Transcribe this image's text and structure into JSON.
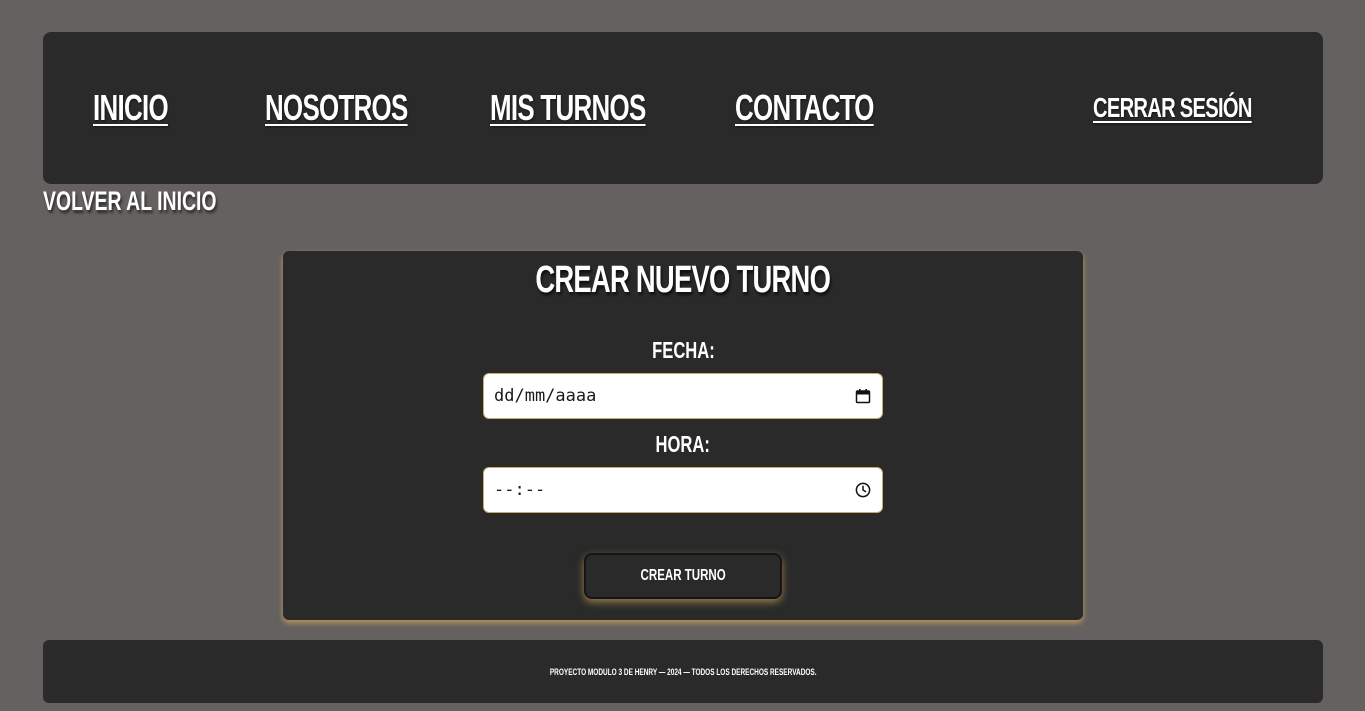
{
  "nav": {
    "items": [
      {
        "label": "INICIO"
      },
      {
        "label": "NOSOTROS"
      },
      {
        "label": "MIS TURNOS"
      },
      {
        "label": "CONTACTO"
      }
    ],
    "logout_label": "CERRAR SESIÓN"
  },
  "back_link": {
    "label": "VOLVER AL INICIO"
  },
  "form": {
    "title": "CREAR NUEVO TURNO",
    "date": {
      "label": "FECHA:",
      "value": "dd/mm/aaaa",
      "icon": "calendar-icon"
    },
    "time": {
      "label": "HORA:",
      "value": "--:--",
      "icon": "clock-icon"
    },
    "submit_label": "CREAR TURNO"
  },
  "footer": {
    "text": "PROYECTO MODULO 3 DE HENRY — 2024 — TODOS LOS DERECHOS RESERVADOS."
  },
  "colors": {
    "page_background": "#656160",
    "panel_background": "#2a2a2a",
    "accent_glow": "#d4aa5a",
    "text": "#ffffff"
  }
}
